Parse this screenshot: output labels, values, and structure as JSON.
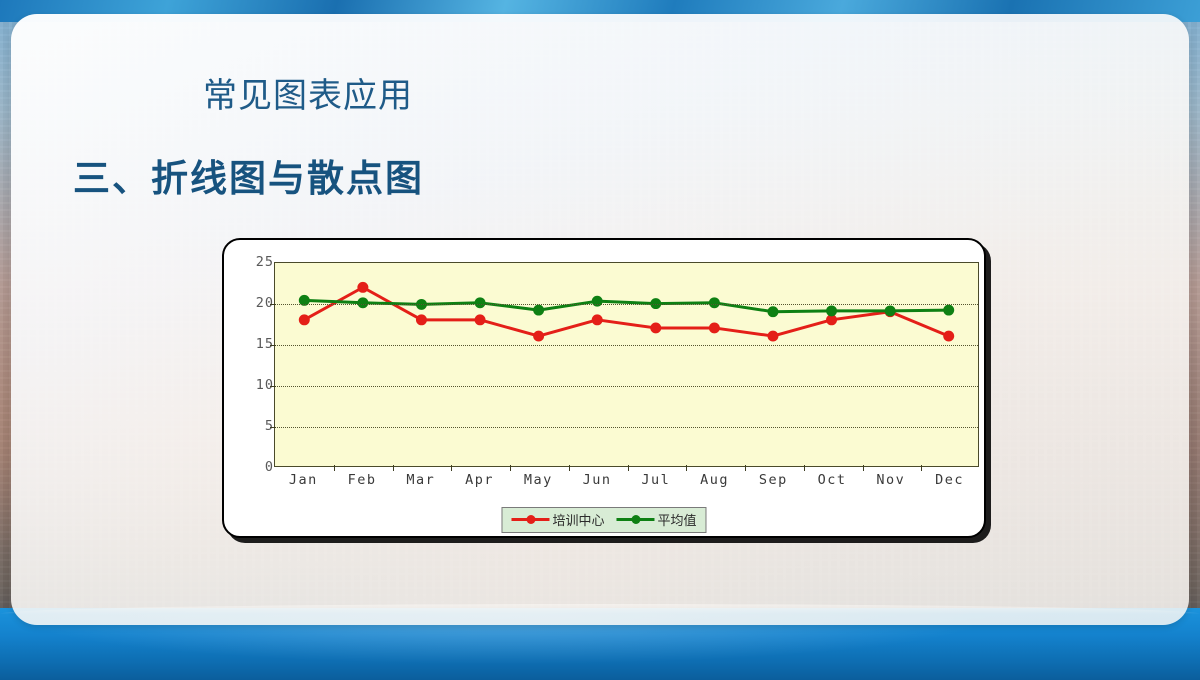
{
  "slide": {
    "heading_sub": "常见图表应用",
    "heading_main": "三、折线图与散点图"
  },
  "colors": {
    "heading_sub": "#1f5b88",
    "heading_main": "#17537f",
    "series_red": "#e41f18",
    "series_green": "#0e8013",
    "plot_background": "#fbfbd2",
    "legend_background": "#d8ecd5",
    "slide_blue": "#1b7fc4"
  },
  "chart_data": {
    "type": "line",
    "title": "",
    "xlabel": "",
    "ylabel": "",
    "ylim": [
      0,
      25
    ],
    "yticks": [
      0,
      5,
      10,
      15,
      20,
      25
    ],
    "grid": true,
    "legend_position": "bottom-center",
    "categories": [
      "Jan",
      "Feb",
      "Mar",
      "Apr",
      "May",
      "Jun",
      "Jul",
      "Aug",
      "Sep",
      "Oct",
      "Nov",
      "Dec"
    ],
    "series": [
      {
        "name": "培训中心",
        "color": "#e41f18",
        "marker": "circle",
        "values": [
          18,
          22,
          18,
          18,
          16,
          18,
          17,
          17,
          16,
          18,
          19,
          16
        ]
      },
      {
        "name": "平均值",
        "color": "#0e8013",
        "marker": "circle",
        "values": [
          20.4,
          20.1,
          19.9,
          20.1,
          19.2,
          20.3,
          20.0,
          20.1,
          19.0,
          19.1,
          19.1,
          19.2
        ]
      }
    ]
  }
}
